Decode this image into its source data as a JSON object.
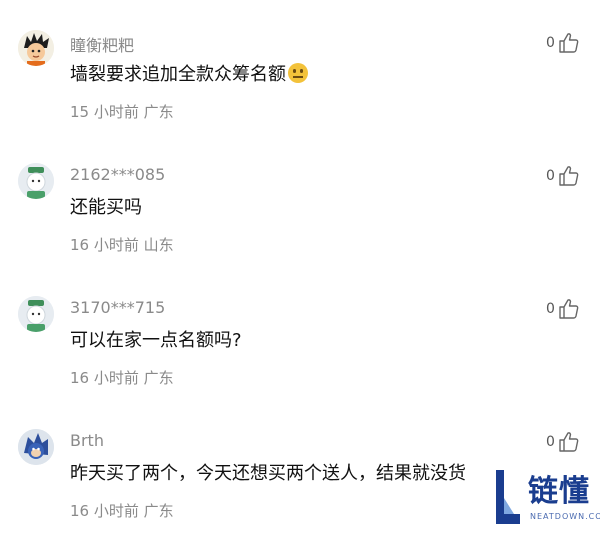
{
  "comments": [
    {
      "username": "瞳衡粑粑",
      "content": "墙裂要求追加全款众筹名额",
      "emoji_icon": "neutral-face-emoji",
      "meta": "15 小时前 广东",
      "likes": "0",
      "avatar_icon": "cartoon-boy-avatar"
    },
    {
      "username": "2162***085",
      "content": "还能买吗",
      "meta": "16 小时前 山东",
      "likes": "0",
      "avatar_icon": "default-robot-avatar"
    },
    {
      "username": "3170***715",
      "content": "可以在家一点名额吗?",
      "meta": "16 小时前 广东",
      "likes": "0",
      "avatar_icon": "default-robot-avatar"
    },
    {
      "username": "Brth",
      "content": "昨天买了两个，今天还想买两个送人，结果就没货",
      "meta": "16 小时前 广东",
      "likes": "0",
      "avatar_icon": "blue-character-avatar"
    }
  ],
  "watermark": {
    "text": "链懂",
    "subtext": "NEATDOWN.COM"
  },
  "colors": {
    "text_primary": "#111111",
    "text_secondary": "#8a8a8a",
    "watermark_blue": "#1a3d8f"
  }
}
